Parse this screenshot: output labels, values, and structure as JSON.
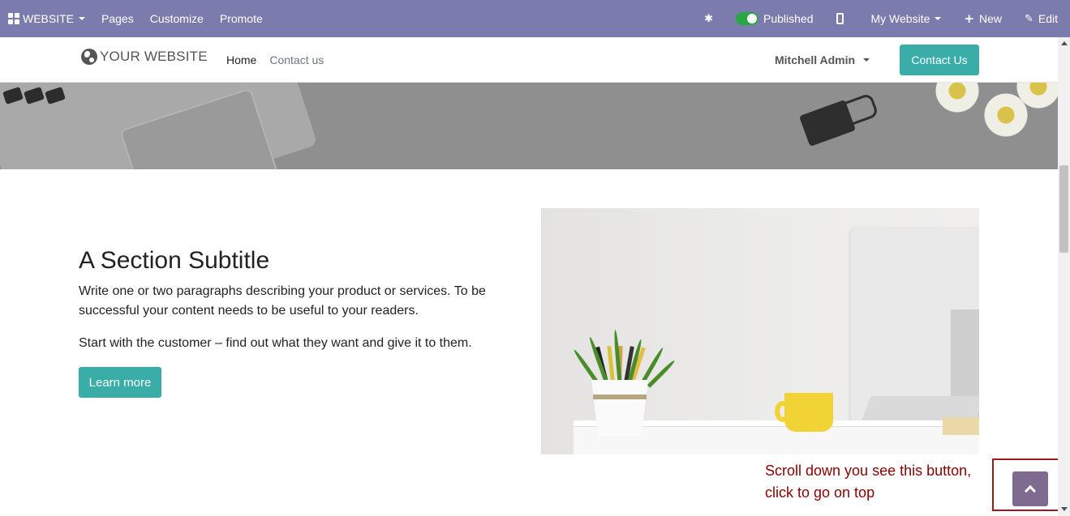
{
  "adminbar": {
    "app_menu": "WEBSITE",
    "items": [
      "Pages",
      "Customize",
      "Promote"
    ],
    "published_label": "Published",
    "website_selector": "My Website",
    "new_label": "New",
    "edit_label": "Edit",
    "colors": {
      "background": "#7c7bad",
      "toggle_on": "#28a745"
    }
  },
  "header": {
    "logo_text": "YOUR WEBSITE",
    "nav": [
      {
        "label": "Home",
        "active": true
      },
      {
        "label": "Contact us",
        "active": false
      }
    ],
    "user_name": "Mitchell Admin",
    "cta_label": "Contact Us",
    "accent_color": "#3aada8"
  },
  "content": {
    "subtitle": "A Section Subtitle",
    "paragraph1": "Write one or two paragraphs describing your product or services. To be successful your content needs to be useful to your readers.",
    "paragraph2": "Start with the customer – find out what they want and give it to them.",
    "learn_more_label": "Learn more"
  },
  "annotation": {
    "text": "Scroll down you see this button, click to go on top",
    "color": "#8b0000"
  },
  "icons": {
    "apps": "apps-grid-icon",
    "debug": "bug-icon",
    "mobile": "mobile-icon",
    "plus": "plus-icon",
    "pencil": "pencil-icon",
    "globe": "globe-icon",
    "scroll_top": "chevron-up-icon"
  }
}
